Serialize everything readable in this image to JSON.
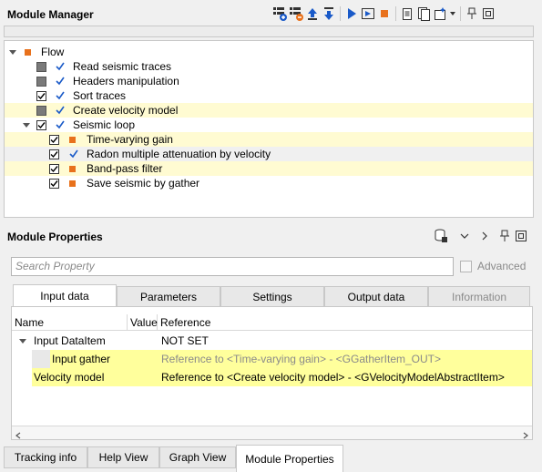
{
  "module_manager": {
    "title": "Module Manager",
    "toolbar": [
      "add-module-icon",
      "remove-module-icon",
      "move-up-icon",
      "move-down-icon",
      "run-icon",
      "run-step-icon",
      "stop-icon",
      "clipboard-icon",
      "document-icon",
      "new-flow-icon",
      "dropdown-icon",
      "pin-icon",
      "float-icon"
    ],
    "tree": {
      "root": "Flow",
      "items": [
        {
          "label": "Read seismic traces"
        },
        {
          "label": "Headers manipulation"
        },
        {
          "label": "Sort traces"
        },
        {
          "label": "Create velocity model"
        },
        {
          "label": "Seismic loop"
        },
        {
          "label": "Time-varying gain"
        },
        {
          "label": "Radon multiple attenuation by velocity"
        },
        {
          "label": "Band-pass filter"
        },
        {
          "label": "Save seismic by gather"
        }
      ]
    }
  },
  "module_properties": {
    "title": "Module Properties",
    "search_placeholder": "Search Property",
    "advanced_label": "Advanced",
    "tabs": [
      "Input data",
      "Parameters",
      "Settings",
      "Output data",
      "Information"
    ],
    "columns": [
      "Name",
      "Value",
      "Reference"
    ],
    "rows": [
      {
        "name": "Input DataItem",
        "value": "",
        "reference": "NOT SET"
      },
      {
        "name": "Input gather",
        "value": "",
        "reference": "Reference to <Time-varying gain> - <GGatherItem_OUT>"
      },
      {
        "name": "Velocity model",
        "value": "",
        "reference": "Reference to <Create velocity model> - <GVelocityModelAbstractItem>"
      }
    ]
  },
  "bottom_tabs": [
    "Tracking info",
    "Help View",
    "Graph View",
    "Module Properties"
  ],
  "colors": {
    "accent_orange": "#e8711c",
    "check_blue": "#1a5ac8",
    "highlight_yellow": "#fffbd2",
    "reference_yellow": "#ffff9c"
  }
}
